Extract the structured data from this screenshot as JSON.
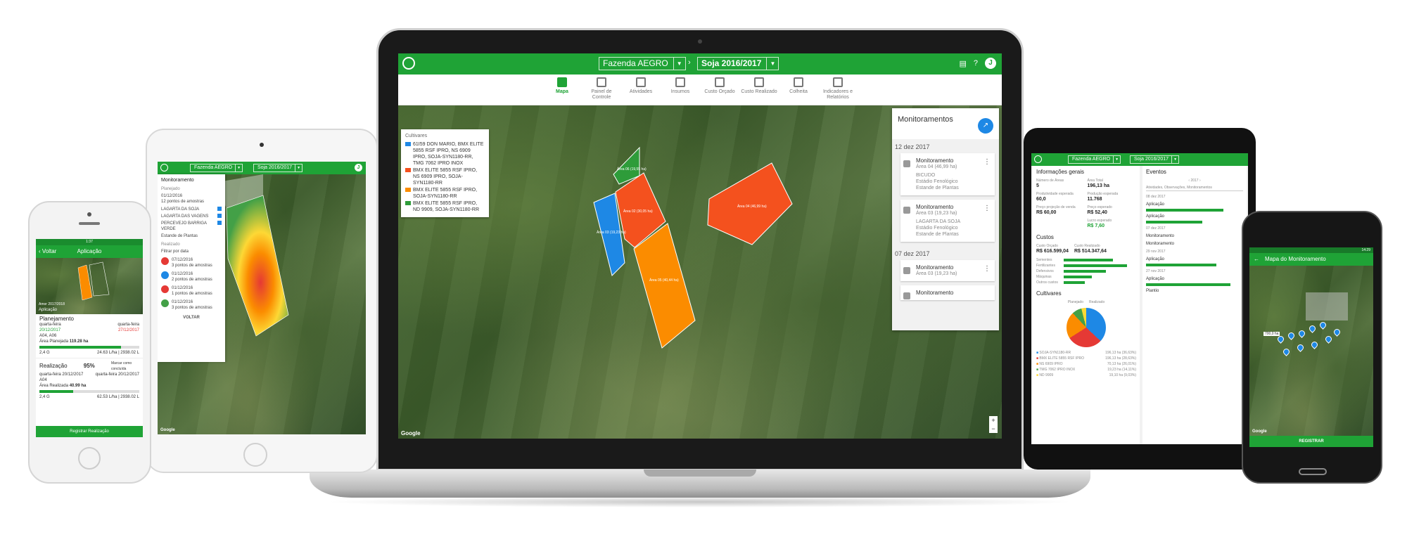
{
  "laptop": {
    "farm_select": "Fazenda AEGRO",
    "season_select": "Soja 2016/2017",
    "avatar_letter": "J",
    "nav": [
      {
        "label": "Mapa"
      },
      {
        "label": "Painel de Controle"
      },
      {
        "label": "Atividades"
      },
      {
        "label": "Insumos"
      },
      {
        "label": "Custo Orçado"
      },
      {
        "label": "Custo Realizado"
      },
      {
        "label": "Colheita"
      },
      {
        "label": "Indicadores e Relatórios"
      }
    ],
    "cultivares": {
      "title": "Cultivares",
      "rows": [
        {
          "text": "61I59 DON MARIO, BMX ELITE 5855 RSF IPRO, NS 6909 IPRO, SOJA-SYN1180-RR, TMG 7062 IPRO INOX",
          "color": "#1e88e5"
        },
        {
          "text": "BMX ELITE 5855 RSF IPRO, NS 6909 IPRO, SOJA-SYN1180-RR",
          "color": "#f4511e"
        },
        {
          "text": "BMX ELITE 5855 RSF IPRO, SOJA-SYN1180-RR",
          "color": "#fb8c00"
        },
        {
          "text": "BMX ELITE 5855 RSF IPRO, ND 9909, SOJA-SYN1180-RR",
          "color": "#2e9c3a"
        }
      ]
    },
    "field_labels": [
      "Área 04 (46,99 ha)",
      "Área 06 (19,55 ha)",
      "Área 02 (30,05 ha)",
      "Área 03 (19,23 ha)",
      "Área 05 (40,44 ha)"
    ],
    "monitoramentos": {
      "title": "Monitoramentos",
      "groups": [
        {
          "date": "12 dez 2017",
          "cards": [
            {
              "title": "Monitoramento",
              "area": "Área 04 (46,99 ha)",
              "pest": "BICUDO",
              "note": "Estádio Fenológico",
              "note2": "Estande de Plantas"
            },
            {
              "title": "Monitoramento",
              "area": "Área 03 (19,23 ha)",
              "pest": "LAGARTA DA SOJA",
              "note": "Estádio Fenológico",
              "note2": "Estande de Plantas"
            }
          ]
        },
        {
          "date": "07 dez 2017",
          "cards": [
            {
              "title": "Monitoramento",
              "area": "Área 03 (19,23 ha)"
            },
            {
              "title": "Monitoramento",
              "area": ""
            }
          ]
        }
      ]
    },
    "map_credit": "Google"
  },
  "ipad": {
    "farm_select": "Fazenda AEGRO",
    "season_select": "Soja 2016/2017",
    "avatar_letter": "J",
    "panel_title": "Monitoramento",
    "planejado_label": "Planejado",
    "plan_date": "01/12/2016",
    "plan_points": "12 pontos de amostras",
    "checks": [
      "LAGARTA DA SOJA",
      "LAGARTA DAS VAGENS",
      "PERCEVEJO BARRIGA VERDE",
      "Estande de Plantas"
    ],
    "realizado_label": "Realizado",
    "filter_label": "Filtrar por data",
    "items": [
      {
        "date": "07/12/2016",
        "points": "3 pontos de amostras",
        "color": "#e53935"
      },
      {
        "date": "01/12/2016",
        "points": "2 pontos de amostras",
        "color": "#1e88e5"
      },
      {
        "date": "01/12/2016",
        "points": "1 pontos de amostras",
        "color": "#e53935"
      },
      {
        "date": "01/12/2016",
        "points": "3 pontos de amostras",
        "color": "#43a047"
      }
    ],
    "button": "VOLTAR",
    "map_credit": "Google"
  },
  "iphone": {
    "status_time": "1:37",
    "back_label": "Voltar",
    "title": "Aplicação",
    "map_caption": "Amor 2017/2018",
    "map_sub": "Aplicação",
    "planejamento": {
      "heading": "Planejamento",
      "start_label": "quarta-feira",
      "start_date": "20/12/2017",
      "end_label": "quarta-feira",
      "end_date": "27/12/2017",
      "area_code": "A04, A06",
      "area_label": "Área Planejada",
      "area_value": "119.28 ha",
      "qty": "2,4 G",
      "total": "24.63 L/ha | 2938.02 L",
      "progress": 0.82
    },
    "realizacao": {
      "heading": "Realização",
      "percent": "95%",
      "mark_label": "Marcar como concluída",
      "start_label": "quarta-feira",
      "start_date": "20/12/2017",
      "end_label": "quarta-feira",
      "end_date": "20/12/2017",
      "area_code": "A04",
      "area_label": "Área Realizada",
      "area_value": "40.99 ha",
      "qty": "2,4 G",
      "total": "62.53 L/ha | 2938.02 L",
      "progress": 0.34
    },
    "button": "Registrar Realização"
  },
  "tablet": {
    "farm_select": "Fazenda AEGRO",
    "season_select": "Soja 2016/2017",
    "info": {
      "heading": "Informações gerais",
      "fields": [
        {
          "label": "Número de Áreas",
          "value": "5"
        },
        {
          "label": "Área Total",
          "value": "196,13 ha"
        },
        {
          "label": "Produtividade esperada",
          "value": "60,0"
        },
        {
          "label": "Produção esperada",
          "value": "11.768"
        },
        {
          "label": "Preço esperado",
          "value": "R$ 52,40"
        },
        {
          "label": "Preço projeção de venda",
          "value": "R$ 60,00"
        },
        {
          "label": "Lucro esperado",
          "value": "R$ 7,60"
        }
      ]
    },
    "custos": {
      "heading": "Custos",
      "orcado_label": "Custo Orçado",
      "orcado": "R$ 616.599,04",
      "realizado_label": "Custo Realizado",
      "realizado": "R$ 514.347,64",
      "rows": [
        "Sementes",
        "Fertilizantes",
        "Defensivos",
        "Máquinas",
        "Outros custos"
      ]
    },
    "cultivares": {
      "heading": "Cultivares",
      "toggle_a": "Planejado",
      "toggle_b": "Realizado",
      "legend": [
        {
          "name": "SOJA-SYN1180-RR",
          "value": "196,13 ha (36,63%)",
          "color": "#1e88e5"
        },
        {
          "name": "BMX ELITE 5855 RSF IPRO",
          "value": "196,13 ha (28,63%)",
          "color": "#e53935"
        },
        {
          "name": "NS 6909 IPRO",
          "value": "70,13 ha (26,01%)",
          "color": "#fb8c00"
        },
        {
          "name": "TMG 7062 IPRO INOX",
          "value": "19,23 ha (14,11%)",
          "color": "#43a047"
        },
        {
          "name": "ND 9909",
          "value": "19,10 ha (9,03%)",
          "color": "#fdd835"
        }
      ]
    },
    "eventos": {
      "heading": "Eventos",
      "year": "2017",
      "filter": "Atividades, Observações, Monitoramentos",
      "dates": [
        "08 dez 2017",
        "07 dez 2017",
        "29 nov 2017",
        "27 nov 2017"
      ],
      "items": [
        "Aplicação",
        "Aplicação",
        "Monitoramento",
        "Monitoramento",
        "Aplicação",
        "Aplicação",
        "Plantio"
      ]
    }
  },
  "droid": {
    "status_time": "14:29",
    "title": "Mapa do Monitoramento",
    "scale_label": "700,0 ha",
    "button": "REGISTRAR",
    "map_credit": "Google"
  }
}
